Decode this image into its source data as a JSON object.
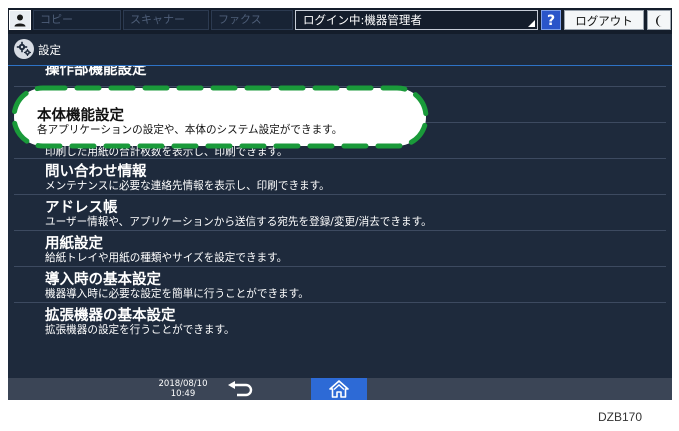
{
  "topbar": {
    "apps": [
      "コピー",
      "スキャナー",
      "ファクス"
    ],
    "login_status": "ログイン中:機器管理者",
    "help_label": "?",
    "logout_label": "ログアウト"
  },
  "header": {
    "title": "設定"
  },
  "list": {
    "items": [
      {
        "title": "操作部機能設定",
        "desc": ""
      },
      {
        "title": "本体機能設定",
        "desc": "各アプリケーションの設定や、本体のシステム設定ができます。"
      },
      {
        "title": "",
        "desc": "印刷した用紙の合計枚数を表示し、印刷できます。"
      },
      {
        "title": "問い合わせ情報",
        "desc": "メンテナンスに必要な連絡先情報を表示し、印刷できます。"
      },
      {
        "title": "アドレス帳",
        "desc": "ユーザー情報や、アプリケーションから送信する宛先を登録/変更/消去できます。"
      },
      {
        "title": "用紙設定",
        "desc": "給紙トレイや用紙の種類やサイズを設定できます。"
      },
      {
        "title": "導入時の基本設定",
        "desc": "機器導入時に必要な設定を簡単に行うことができます。"
      },
      {
        "title": "拡張機器の基本設定",
        "desc": "拡張機器の設定を行うことができます。"
      }
    ]
  },
  "bottombar": {
    "date": "2018/08/10",
    "time": "10:49"
  },
  "figure_code": "DZB170",
  "colors": {
    "highlight_dash": "#1a9a3a",
    "accent": "#2d6ad6"
  }
}
